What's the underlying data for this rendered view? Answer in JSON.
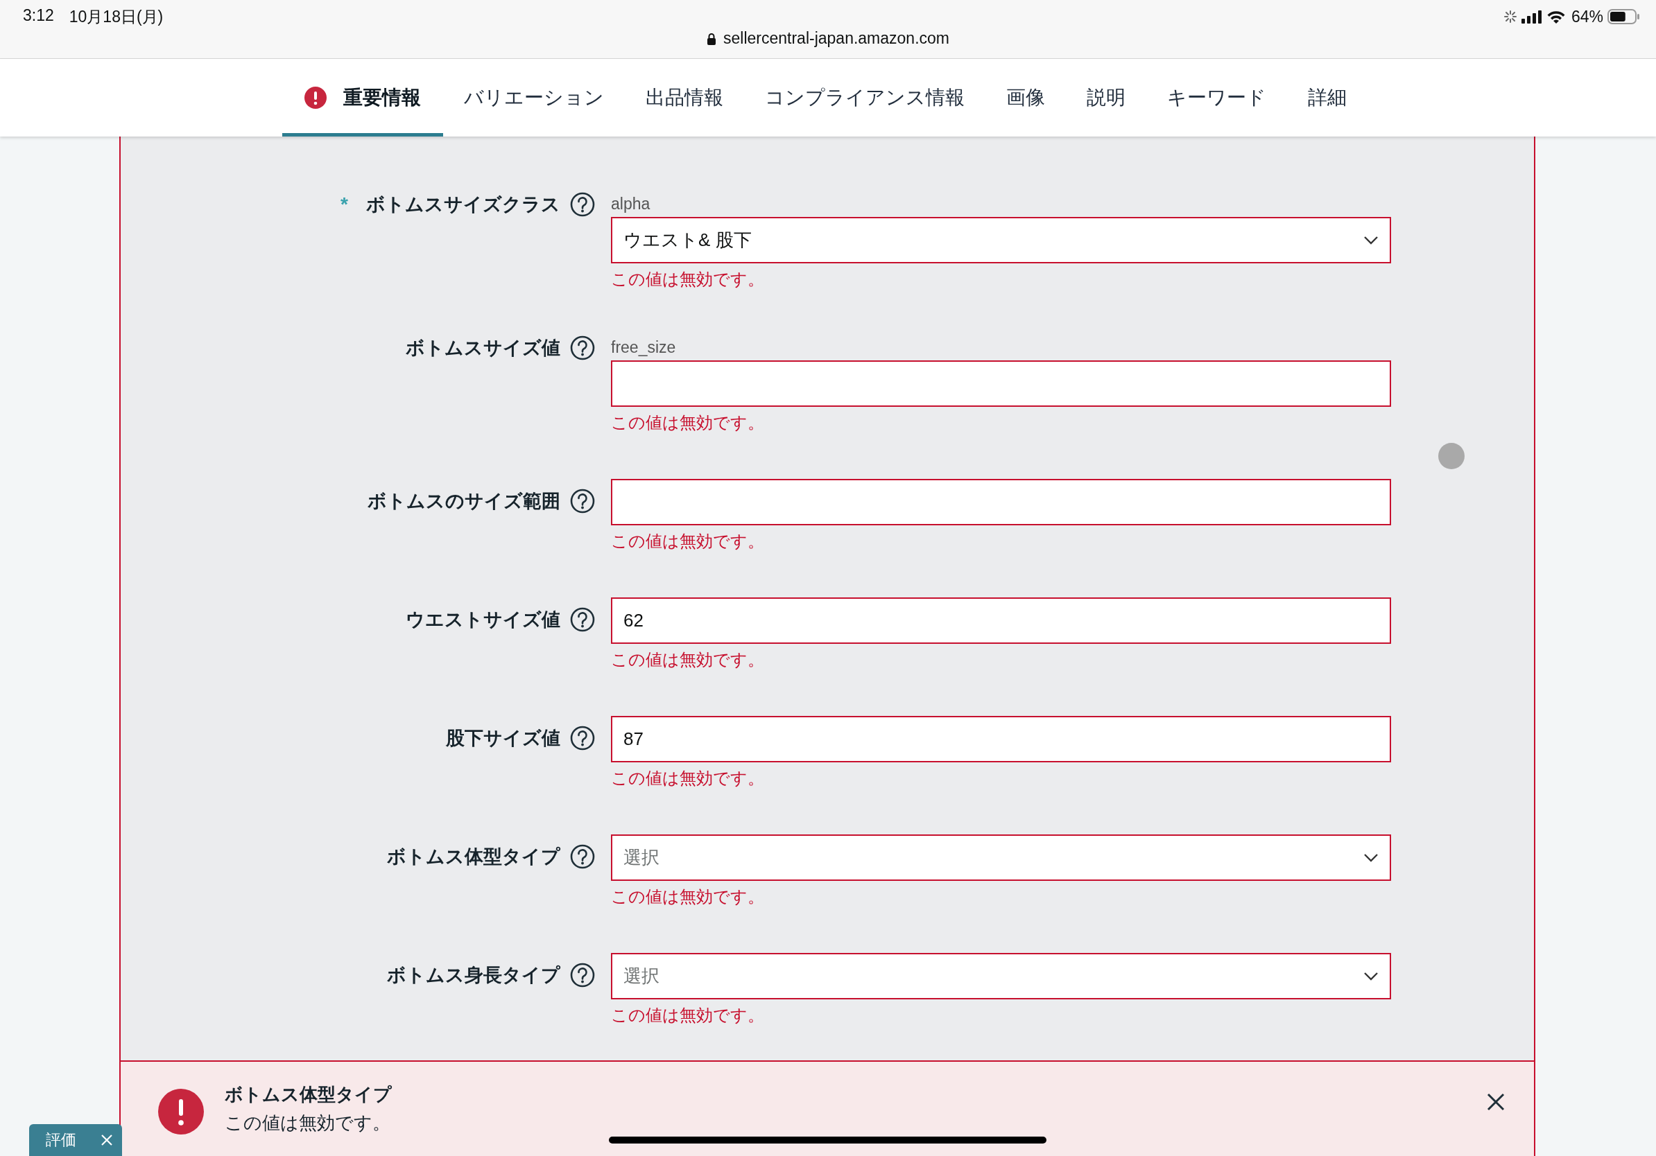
{
  "status_bar": {
    "time": "3:12",
    "date": "10月18日(月)",
    "battery": "64%",
    "url": "sellercentral-japan.amazon.com"
  },
  "tabs": [
    {
      "label": "重要情報",
      "selected": true,
      "error": true
    },
    {
      "label": "バリエーション",
      "selected": false,
      "error": false
    },
    {
      "label": "出品情報",
      "selected": false,
      "error": false
    },
    {
      "label": "コンプライアンス情報",
      "selected": false,
      "error": false
    },
    {
      "label": "画像",
      "selected": false,
      "error": false
    },
    {
      "label": "説明",
      "selected": false,
      "error": false
    },
    {
      "label": "キーワード",
      "selected": false,
      "error": false
    },
    {
      "label": "詳細",
      "selected": false,
      "error": false
    }
  ],
  "fields": [
    {
      "label": "ボトムスサイズクラス",
      "required_mark": "*",
      "hint": "alpha",
      "kind": "select",
      "value": "ウエスト& 股下",
      "invalid": true,
      "error": "この値は無効です。"
    },
    {
      "label": "ボトムスサイズ値",
      "hint": "free_size",
      "kind": "text",
      "invalid": true,
      "error": "この値は無効です。"
    },
    {
      "label": "ボトムスのサイズ範囲",
      "kind": "text",
      "invalid": true,
      "error": "この値は無効です。"
    },
    {
      "label": "ウエストサイズ値",
      "kind": "text",
      "value": "62",
      "invalid": true,
      "error": "この値は無効です。"
    },
    {
      "label": "股下サイズ値",
      "kind": "text",
      "value": "87",
      "invalid": true,
      "error": "この値は無効です。"
    },
    {
      "label": "ボトムス体型タイプ",
      "kind": "select",
      "placeholder": "選択",
      "invalid": true,
      "error": "この値は無効です。"
    },
    {
      "label": "ボトムス身長タイプ",
      "kind": "select",
      "placeholder": "選択",
      "invalid": true,
      "error": "この値は無効です。"
    }
  ],
  "alert": {
    "title": "ボトムス体型タイプ",
    "message": "この値は無効です。"
  },
  "feedback_tab": {
    "label": "評価"
  }
}
